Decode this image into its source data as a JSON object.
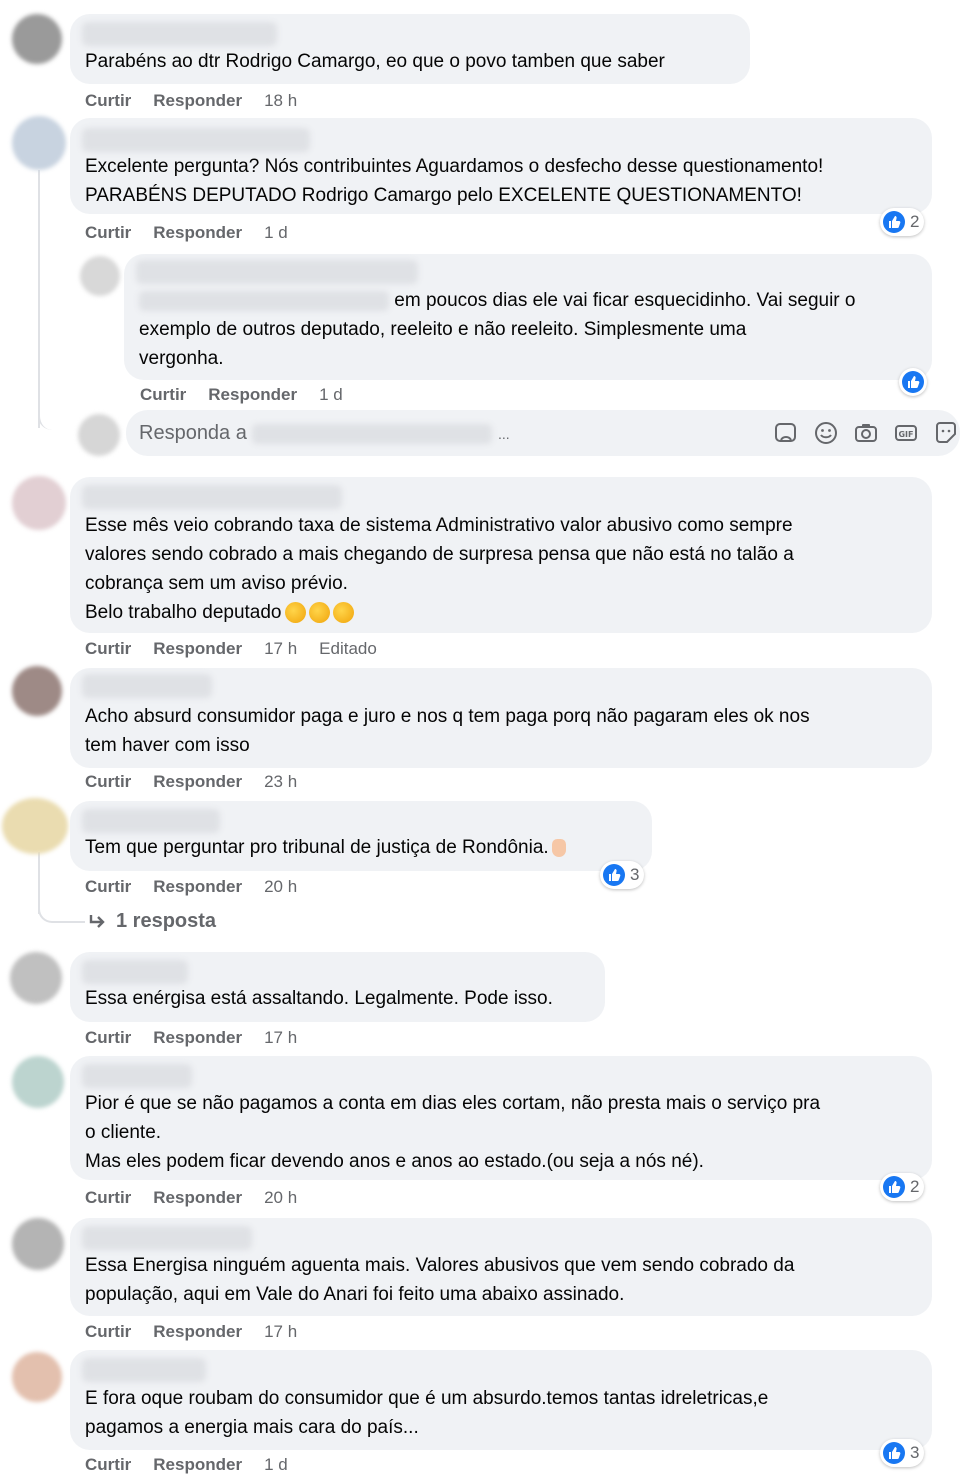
{
  "actions": {
    "like": "Curtir",
    "reply": "Responder",
    "edited": "Editado"
  },
  "comments": [
    {
      "text": "Parabéns ao dtr Rodrigo Camargo, eo que o povo tamben que saber",
      "time": "18 h"
    },
    {
      "text": "Excelente pergunta? Nós contribuintes Aguardamos o desfecho desse questionamento!\nPARABÉNS DEPUTADO Rodrigo Camargo pelo EXCELENTE QUESTIONAMENTO!",
      "time": "1 d",
      "reactions": "2"
    },
    {
      "text": "Esse mês veio cobrando taxa de sistema Administrativo valor abusivo como sempre\nvalores sendo cobrado a mais chegando de surpresa pensa que não está no talão a\ncobrança sem um aviso prévio.\nBelo trabalho deputado",
      "time": "17 h"
    },
    {
      "text": "Acho absurd consumidor paga e juro e nos q tem paga porq não pagaram eles ok nos\ntem haver com isso",
      "time": "23 h"
    },
    {
      "text": "Tem que perguntar pro tribunal de justiça de Rondônia.",
      "time": "20 h",
      "reactions": "3",
      "replies": "1 resposta"
    },
    {
      "text": "Essa enérgisa está assaltando. Legalmente. Pode isso.",
      "time": "17 h"
    },
    {
      "text": "Pior é que se não pagamos a conta em dias eles cortam, não presta mais o serviço pra\no cliente.\nMas eles podem ficar devendo anos e anos ao estado.(ou seja a nós né).",
      "time": "20 h",
      "reactions": "2"
    },
    {
      "text": "Essa Energisa ninguém aguenta mais. Valores abusivos que vem sendo cobrado da\npopulação, aqui em Vale do Anari foi feito uma abaixo assinado.",
      "time": "17 h"
    },
    {
      "text": "E fora oque roubam do consumidor que é um absurdo.temos tantas idreletricas,e\npagamos a energia mais cara do país...",
      "time": "1 d",
      "reactions": "3"
    }
  ],
  "nested_reply": {
    "text": "em poucos dias ele vai ficar esquecidinho. Vai seguir o\nexemplo de outros deputado, reeleito e não reeleito. Simplesmente uma\nvergonha.",
    "time": "1 d"
  },
  "reply_box": {
    "placeholder": "Responda a",
    "ellipsis": "..."
  },
  "icons": [
    "sticker-icon",
    "emoji-icon",
    "camera-icon",
    "gif-icon",
    "sticker-face-icon",
    "like-icon"
  ],
  "colors": {
    "like_blue": "#1877f2",
    "bubble": "#f0f2f5",
    "meta_text": "#65676b"
  }
}
